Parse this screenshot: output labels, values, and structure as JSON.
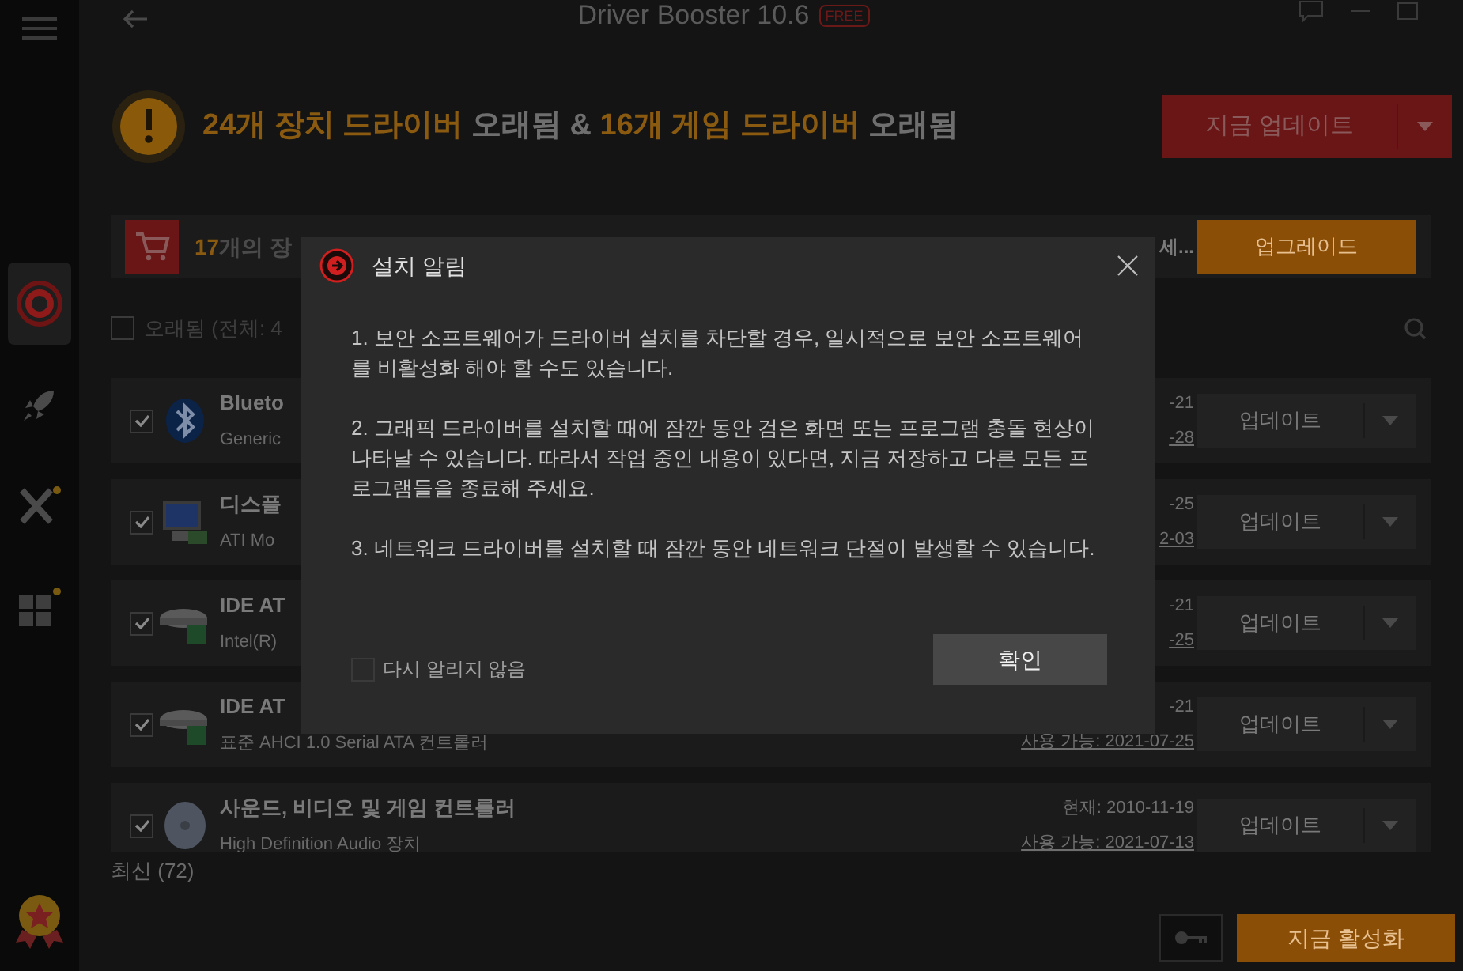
{
  "title_bar": {
    "title": "Driver Booster 10.6",
    "badge": "FREE"
  },
  "sidebar": {
    "items": [
      {
        "kind": "target",
        "selected": true
      },
      {
        "kind": "rocket",
        "selected": false
      },
      {
        "kind": "tools",
        "selected": false
      },
      {
        "kind": "grid",
        "selected": false
      }
    ]
  },
  "header": {
    "segments": [
      {
        "text": "24개 장치 드라이버",
        "highlight": true
      },
      {
        "text": " 오래됨 & ",
        "highlight": false
      },
      {
        "text": "16개 게임 드라이버",
        "highlight": true
      },
      {
        "text": " 오래됨",
        "highlight": false
      }
    ],
    "update_button": "지금 업데이트"
  },
  "promo": {
    "segments": [
      {
        "text": "17",
        "highlight": true
      },
      {
        "text": "개의 장",
        "highlight": false
      }
    ],
    "tail": "세...",
    "button": "업그레이드"
  },
  "filter": {
    "label": "오래됨 (전체: 4",
    "checked": false
  },
  "devices": [
    {
      "kind": "bluetooth",
      "name": "Blueto",
      "subtitle": "Generic",
      "checked": true,
      "current": "-21",
      "available": "-28",
      "button": "업데이트"
    },
    {
      "kind": "monitor",
      "name": "디스플",
      "subtitle": "ATI Mo",
      "checked": true,
      "current": "-25",
      "available": "2-03",
      "button": "업데이트"
    },
    {
      "kind": "disk",
      "name": "IDE AT",
      "subtitle": "Intel(R)",
      "checked": true,
      "current": "-21",
      "available": "-25",
      "button": "업데이트"
    },
    {
      "kind": "disk",
      "name": "IDE AT",
      "subtitle": "표준 AHCI 1.0 Serial ATA 컨트롤러",
      "checked": true,
      "current": "-21",
      "available": "사용 가능: 2021-07-25",
      "button": "업데이트"
    },
    {
      "kind": "speaker",
      "name": "사운드, 비디오 및 게임 컨트롤러",
      "subtitle": "High Definition Audio 장치",
      "checked": true,
      "current": "현재: 2010-11-19",
      "available": "사용 가능: 2021-07-13",
      "button": "업데이트"
    }
  ],
  "up_to_date": "최신 (72)",
  "activate_button": "지금 활성화",
  "dialog": {
    "title": "설치 알림",
    "paragraphs": [
      "1. 보안 소프트웨어가 드라이버 설치를 차단할 경우, 일시적으로 보안 소프트웨어를 비활성화 해야 할 수도 있습니다.",
      "2. 그래픽 드라이버를 설치할 때에 잠깐 동안 검은 화면 또는 프로그램 충돌 현상이 나타날 수 있습니다. 따라서 작업 중인 내용이 있다면, 지금 저장하고 다른 모든 프로그램들을 종료해 주세요.",
      "3. 네트워크 드라이버를 설치할 때 잠깐 동안 네트워크 단절이 발생할 수 있습니다."
    ],
    "dont_show": {
      "label": "다시 알리지 않음",
      "checked": false
    },
    "ok_button": "확인"
  }
}
